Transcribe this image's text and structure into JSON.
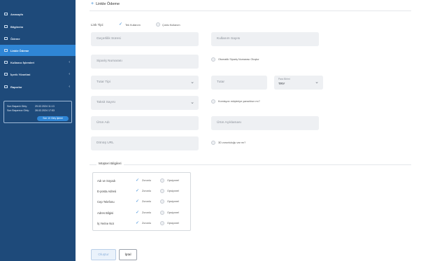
{
  "sidebar": {
    "items": [
      {
        "label": "Anasayfa",
        "icon": "home-icon"
      },
      {
        "label": "Bilgilerim",
        "icon": "user-icon"
      },
      {
        "label": "Ödeme",
        "icon": "card-icon"
      },
      {
        "label": "Linkle Ödeme",
        "icon": "link-icon",
        "active": true
      },
      {
        "label": "Kullanıcı İşlemleri",
        "icon": "users-icon",
        "expandable": true
      },
      {
        "label": "İçerik Yönetimi",
        "icon": "content-icon",
        "expandable": true
      },
      {
        "label": "Raporlar",
        "icon": "report-icon",
        "expandable": true
      }
    ],
    "login_info": {
      "last_success_label": "Son Başarılı Giriş:",
      "last_success_value": "29.02.2024 11:13",
      "last_fail_label": "Son Başarısız Giriş:",
      "last_fail_value": "28.02.2024 17:53",
      "all_logins_button": "Son 10 Giriş İşlemi"
    }
  },
  "page": {
    "title": "Linkle Ödeme",
    "link_type_label": "Link Tipi:",
    "link_type_single": "Tek Kullanım",
    "link_type_multi": "Çoklu Kullanım"
  },
  "form": {
    "validity_period_placeholder": "Geçerlilik Süresi",
    "usage_count_placeholder": "Kullanım Sayısı",
    "order_number_placeholder": "Sipariş Numarası",
    "auto_order_label": "Otomatik Sipariş Numarası Oluştur",
    "amount_type_placeholder": "Tutar Tipi",
    "amount_placeholder": "Tutar",
    "currency_label": "Para Birimi",
    "currency_value": "TRY",
    "installment_placeholder": "Taksit Sayısı",
    "commission_label": "Komisyon müşteriye yansıtılsın mı?",
    "product_name_placeholder": "Ürün Adı",
    "product_desc_placeholder": "Ürün Açıklaması",
    "return_url_placeholder": "Dönüş URL",
    "three_d_label": "3D zorunluluğu var mı?"
  },
  "customer_info": {
    "title": "Müşteri Bilgileri",
    "required_label": "Zorunlu",
    "optional_label": "Opsiyonel",
    "rows": [
      {
        "label": "Adı ve Soyadı"
      },
      {
        "label": "E-posta Adresi"
      },
      {
        "label": "Cep Telefonu"
      },
      {
        "label": "Adres Bilgisi"
      },
      {
        "label": "İş Yerine Not"
      }
    ]
  },
  "actions": {
    "submit": "Oluştur",
    "cancel": "İptal"
  },
  "colors": {
    "sidebar_bg": "#1e4a7a",
    "accent": "#2f86d6",
    "input_bg": "#eef0f3"
  }
}
